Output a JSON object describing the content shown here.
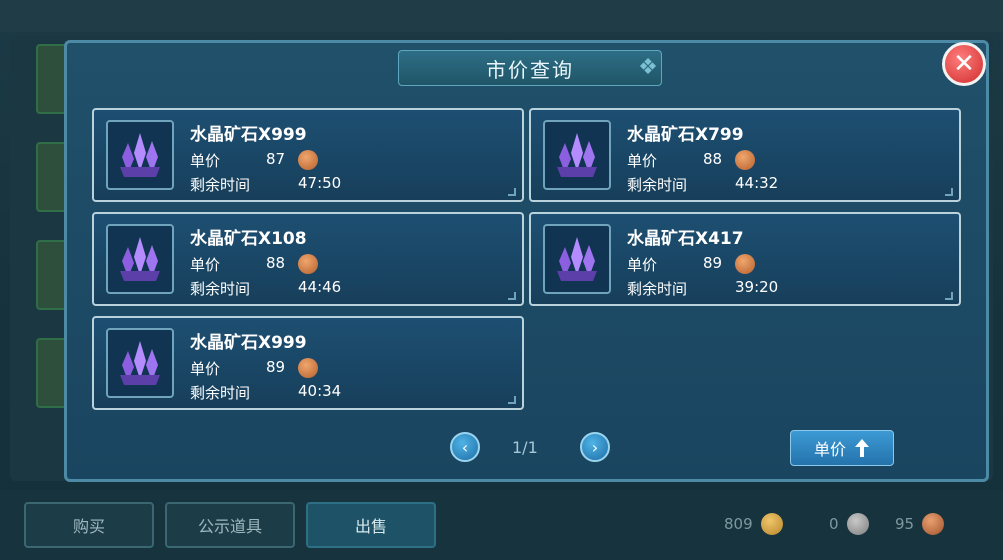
{
  "dialog": {
    "title": "市价查询",
    "close_label": "✕"
  },
  "listings": [
    {
      "name": "水晶矿石X999",
      "price_label": "单价",
      "price": "87",
      "time_label": "剩余时间",
      "time": "47:50"
    },
    {
      "name": "水晶矿石X799",
      "price_label": "单价",
      "price": "88",
      "time_label": "剩余时间",
      "time": "44:32"
    },
    {
      "name": "水晶矿石X108",
      "price_label": "单价",
      "price": "88",
      "time_label": "剩余时间",
      "time": "44:46"
    },
    {
      "name": "水晶矿石X417",
      "price_label": "单价",
      "price": "89",
      "time_label": "剩余时间",
      "time": "39:20"
    },
    {
      "name": "水晶矿石X999",
      "price_label": "单价",
      "price": "89",
      "time_label": "剩余时间",
      "time": "40:34"
    }
  ],
  "pagination": {
    "page": "1/1",
    "prev_icon": "chevron-left-icon",
    "next_icon": "chevron-right-icon"
  },
  "sort_button": {
    "label": "单价",
    "icon": "arrow-up-icon"
  },
  "bottom_tabs": [
    {
      "label": "购买"
    },
    {
      "label": "公示道具"
    },
    {
      "label": "出售"
    }
  ],
  "currencies": [
    {
      "amount": "809",
      "icon": "gold-coin-icon"
    },
    {
      "amount": "0",
      "icon": "silver-coin-icon"
    },
    {
      "amount": "95",
      "icon": "bronze-coin-icon"
    }
  ],
  "colors": {
    "dialog_bg": "#1a4560",
    "card_border": "#b9d2dc",
    "close_red": "#d02c2c",
    "button_blue": "#2473ac"
  }
}
